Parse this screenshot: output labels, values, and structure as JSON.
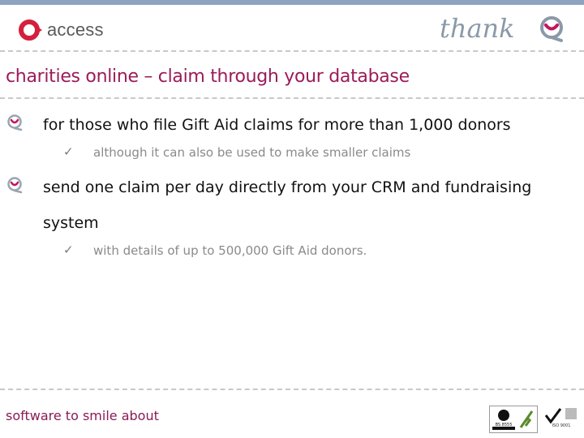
{
  "header": {
    "brand_left": "access",
    "brand_right": "thankQ"
  },
  "title": "charities online – claim through your database",
  "bullets": [
    {
      "text": "for those who file Gift Aid claims for more than 1,000 donors",
      "sub": "although it can also be used to make smaller claims"
    },
    {
      "text_line1": "send one claim per day directly from your CRM and fundraising",
      "text_line2": "system",
      "sub": "with details of up to 500,000 Gift Aid donors."
    }
  ],
  "footer": {
    "tagline": "software to smile about",
    "badge_bsi": "BS 8555 Registered",
    "badge_iso": "ISO 9001 Registered Firm"
  },
  "colors": {
    "accent": "#9b1b5a",
    "top_bar": "#8ea3bf",
    "access_red": "#d4203c"
  },
  "icons": {
    "check": "✓"
  }
}
